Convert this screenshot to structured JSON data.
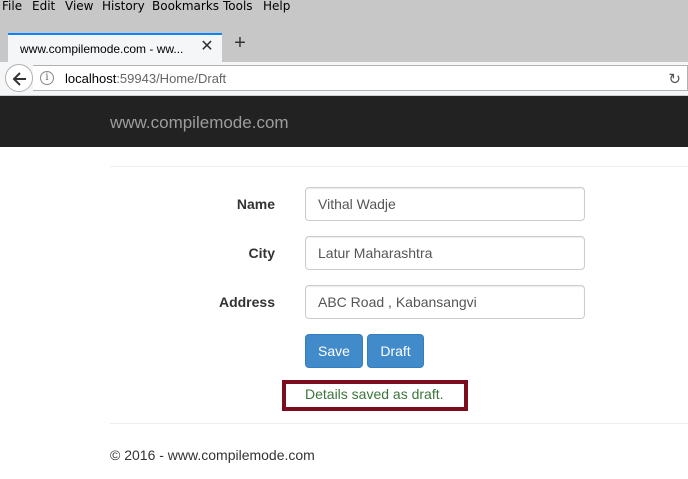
{
  "menu": {
    "items": [
      {
        "label": "File",
        "underline": "F"
      },
      {
        "label": "Edit"
      },
      {
        "label": "View"
      },
      {
        "label": "History"
      },
      {
        "label": "Bookmarks"
      },
      {
        "label": "Tools"
      },
      {
        "label": "Help"
      }
    ]
  },
  "browser": {
    "tab_title": "www.compilemode.com - ww...",
    "tab_close": "✕",
    "new_tab": "+",
    "url_host": "localhost",
    "url_rest": ":59943/Home/Draft",
    "info_glyph": "i",
    "reload_glyph": "↻"
  },
  "site": {
    "brand": "www.compilemode.com"
  },
  "form": {
    "name_label": "Name",
    "name_value": "Vithal Wadje",
    "city_label": "City",
    "city_value": "Latur Maharashtra",
    "address_label": "Address",
    "address_value": "ABC Road , Kabansangvi",
    "save_label": "Save",
    "draft_label": "Draft",
    "status_message": "Details saved as draft."
  },
  "footer": {
    "text": "© 2016 - www.compilemode.com"
  },
  "colors": {
    "status_green": "#3c763d",
    "button_blue": "#428bca",
    "highlight_border": "#7b0d1e",
    "navbar_dark": "#222222"
  }
}
